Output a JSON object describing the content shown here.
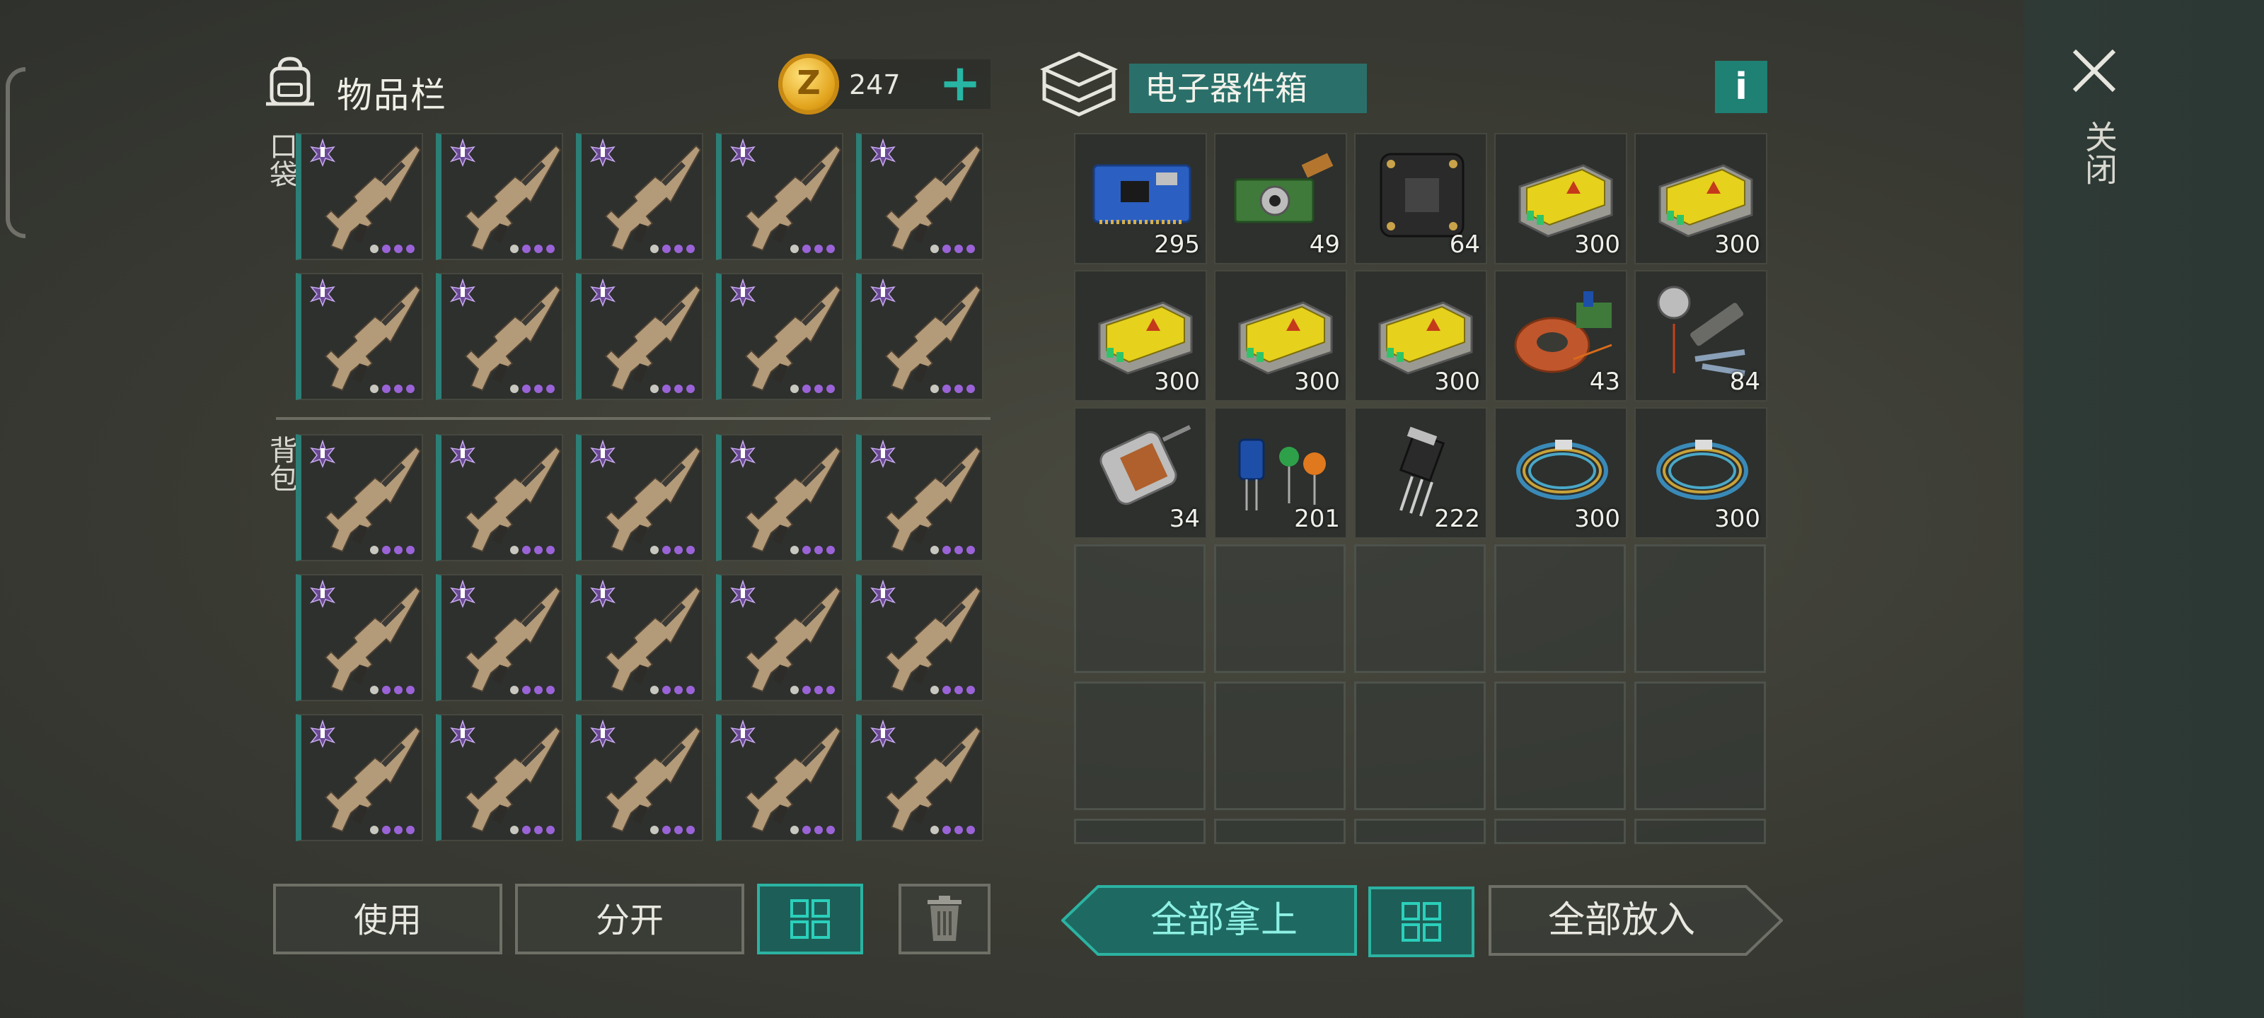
{
  "inventory": {
    "title": "物品栏",
    "coins": "247",
    "coin_symbol": "Z",
    "plus": "+",
    "pocket_label": "口袋",
    "backpack_label": "背包"
  },
  "container": {
    "title": "电子器件箱",
    "info": "i",
    "items": [
      {
        "name": "circuit-board-blue",
        "count": "295"
      },
      {
        "name": "camera-module",
        "count": "49"
      },
      {
        "name": "flight-controller",
        "count": "64"
      },
      {
        "name": "battery-pack",
        "count": "300"
      },
      {
        "name": "battery-pack",
        "count": "300"
      },
      {
        "name": "battery-pack",
        "count": "300"
      },
      {
        "name": "battery-pack",
        "count": "300"
      },
      {
        "name": "battery-pack",
        "count": "300"
      },
      {
        "name": "copper-coil",
        "count": "43"
      },
      {
        "name": "drone-motor-parts",
        "count": "84"
      },
      {
        "name": "electric-motor",
        "count": "34"
      },
      {
        "name": "capacitors",
        "count": "201"
      },
      {
        "name": "transistor",
        "count": "222"
      },
      {
        "name": "wire-bundle",
        "count": "300"
      },
      {
        "name": "wire-bundle",
        "count": "300"
      }
    ]
  },
  "close_label": "关闭",
  "buttons": {
    "use": "使用",
    "split": "分开",
    "take_all": "全部拿上",
    "put_all": "全部放入"
  },
  "colors": {
    "accent": "#2bb3a2",
    "rarity_purple": "#9b63d8",
    "coin_gold": "#e2a31c"
  },
  "item_rarity_dots": {
    "purple": 3,
    "gray": 1
  }
}
